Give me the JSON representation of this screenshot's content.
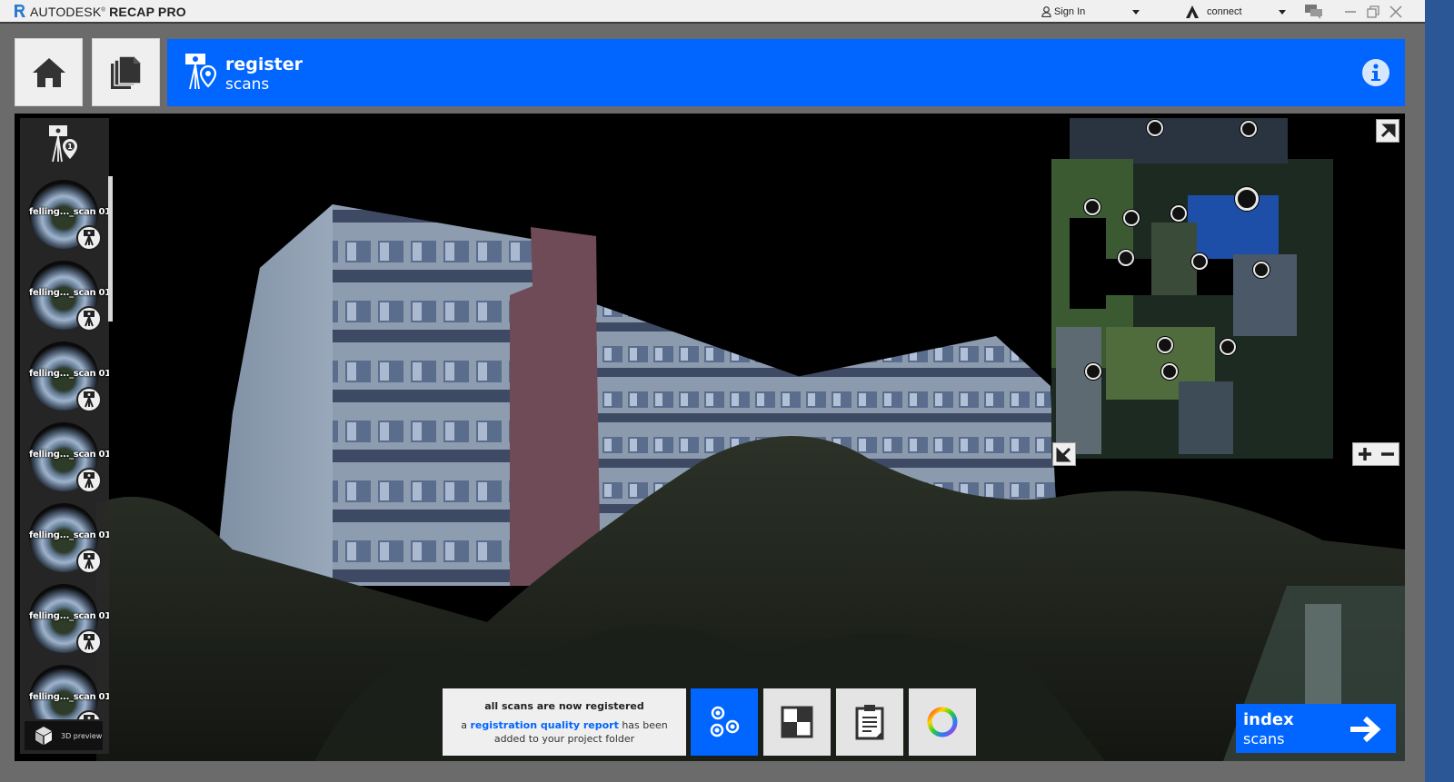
{
  "titlebar": {
    "brand": "AUTODESK",
    "product": "RECAP PRO",
    "sign_in": "Sign In",
    "connect": "connect",
    "icons": [
      "recap-logo-icon",
      "user-icon",
      "autodesk-logo-icon",
      "chat-icon",
      "minimize-icon",
      "restore-icon",
      "close-icon"
    ]
  },
  "header": {
    "home_icon": "home-icon",
    "projects_icon": "documents-icon",
    "stage_title": "register",
    "stage_subtitle": "scans",
    "info_icon": "info-icon",
    "accent_color": "#0066ff"
  },
  "scans_panel": {
    "header_icon": "scan-location-icon",
    "header_badge": "1",
    "items": [
      {
        "name": "felling..._scan 01"
      },
      {
        "name": "felling..._scan 01"
      },
      {
        "name": "felling..._scan 01"
      },
      {
        "name": "felling..._scan 01"
      },
      {
        "name": "felling..._scan 01"
      },
      {
        "name": "felling..._scan 01"
      },
      {
        "name": "felling..._scan 01"
      }
    ],
    "preview_label": "3D preview"
  },
  "minimap": {
    "expand_icon": "expand-arrow-icon",
    "collapse_icon": "collapse-arrow-icon",
    "zoom_in_icon": "plus-icon",
    "zoom_out_icon": "minus-icon"
  },
  "notice": {
    "title": "all scans are now registered",
    "prefix": "a",
    "link": "registration quality report",
    "suffix": "has been added to your project folder"
  },
  "toolbar": {
    "buttons": [
      {
        "icon": "scan-cluster-icon",
        "active": true
      },
      {
        "icon": "checkerboard-icon",
        "active": false
      },
      {
        "icon": "clipboard-report-icon",
        "active": false
      },
      {
        "icon": "color-wheel-icon",
        "active": false
      }
    ]
  },
  "next_step": {
    "title": "index",
    "subtitle": "scans",
    "icon": "arrow-right-icon"
  }
}
